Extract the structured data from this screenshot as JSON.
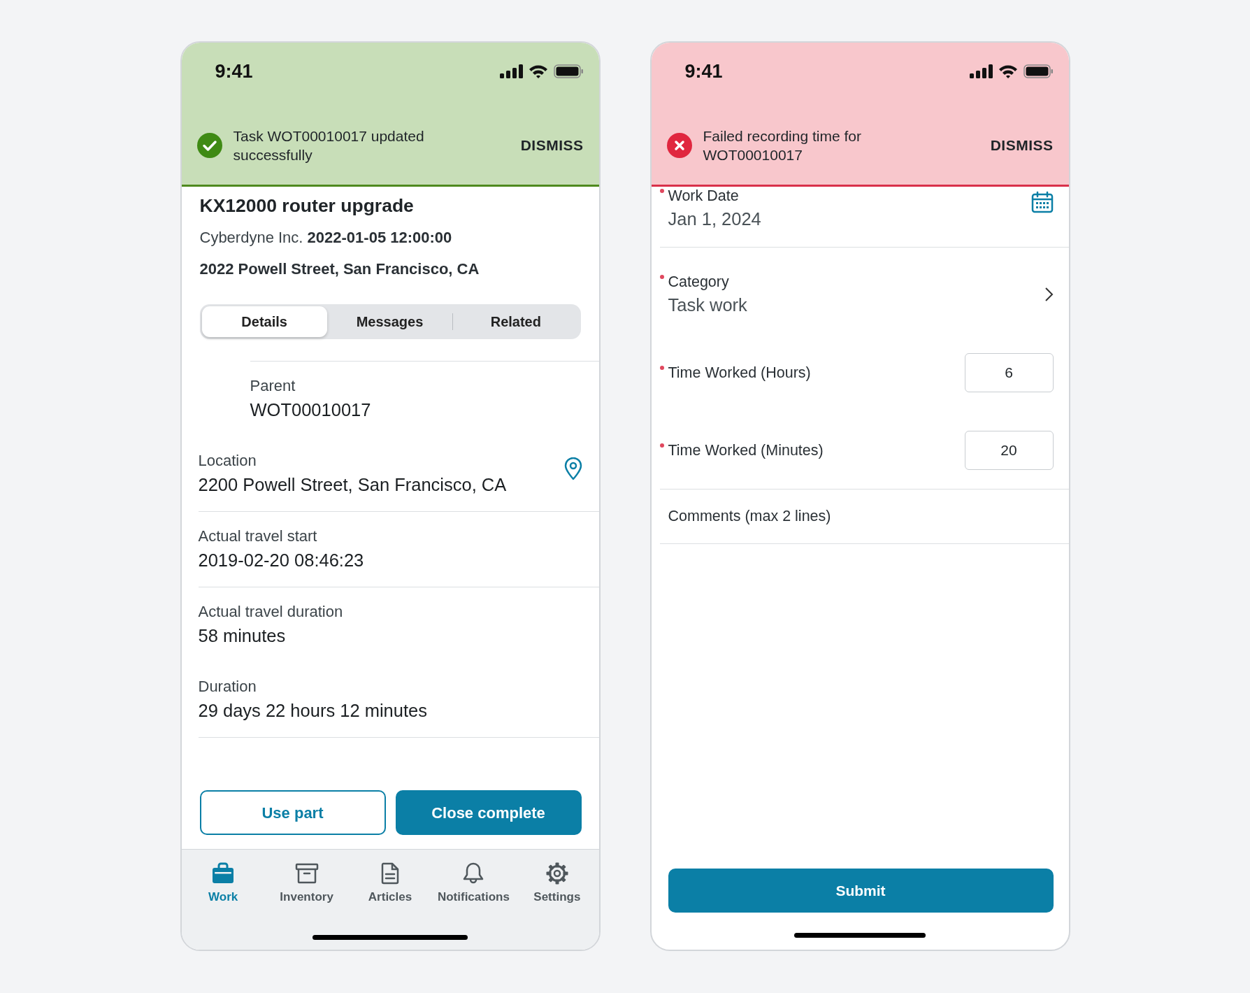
{
  "task_screen": {
    "status_bar": {
      "time": "9:41"
    },
    "toast": {
      "kind": "success",
      "message": "Task WOT00010017 updated successfully",
      "action": "DISMISS"
    },
    "header": {
      "title": "KX12000 router upgrade",
      "account": "Cyberdyne Inc.",
      "date": "2022-01-05 12:00:00",
      "address": "2022 Powell Street, San Francisco, CA"
    },
    "tabs": [
      {
        "label": "Details",
        "selected": true
      },
      {
        "label": "Messages",
        "selected": false
      },
      {
        "label": "Related",
        "selected": false
      }
    ],
    "fields": [
      {
        "kind": "indented",
        "label": "Parent",
        "value": "WOT00010017",
        "divider": false
      },
      {
        "kind": "location",
        "label": "Location",
        "value": "2200 Powell Street, San Francisco, CA",
        "divider": true
      },
      {
        "kind": "plain",
        "label": "Actual travel start",
        "value": "2019-02-20 08:46:23",
        "divider": true
      },
      {
        "kind": "plain",
        "label": "Actual travel duration",
        "value": "58 minutes",
        "divider": false
      },
      {
        "kind": "plain",
        "label": "Duration",
        "value": "29 days 22 hours 12 minutes",
        "divider": true
      }
    ],
    "actions": [
      {
        "kind": "outline",
        "label": "Use part"
      },
      {
        "kind": "primary",
        "label": "Close complete"
      }
    ],
    "nav": [
      {
        "label": "Work",
        "selected": true
      },
      {
        "label": "Inventory",
        "selected": false
      },
      {
        "label": "Articles",
        "selected": false
      },
      {
        "label": "Notifications",
        "selected": false
      },
      {
        "label": "Settings",
        "selected": false
      }
    ]
  },
  "time_entry_screen": {
    "status_bar": {
      "time": "9:41"
    },
    "toast": {
      "kind": "error",
      "message": "Failed recording time for WOT00010017",
      "action": "DISMISS"
    },
    "fields": [
      {
        "kind": "date",
        "label": "Work Date",
        "value": "Jan 1, 2024",
        "required": true
      },
      {
        "kind": "picker",
        "label": "Category",
        "value": "Task work",
        "required": true
      },
      {
        "kind": "number",
        "label": "Time Worked (Hours)",
        "value": "6",
        "required": true
      },
      {
        "kind": "number",
        "label": "Time Worked (Minutes)",
        "value": "20",
        "required": true
      },
      {
        "kind": "text",
        "placeholder": "Comments (max 2 lines)",
        "required": false
      }
    ],
    "submit": "Submit"
  }
}
